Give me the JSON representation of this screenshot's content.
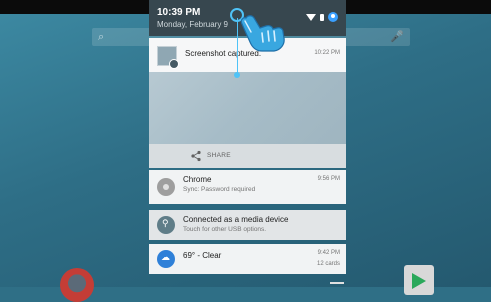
{
  "status": {
    "time": "10:39 PM",
    "date": "Monday, February 9"
  },
  "notifications": {
    "screenshot": {
      "title": "Screenshot captured.",
      "time": "10:22 PM",
      "action": "SHARE"
    },
    "chrome": {
      "title": "Chrome",
      "subtitle": "Sync: Password required",
      "time": "9:56 PM"
    },
    "usb": {
      "title": "Connected as a media device",
      "subtitle": "Touch for other USB options."
    },
    "weather": {
      "title": "69° - Clear",
      "time": "9:42 PM",
      "meta": "12 cards"
    }
  },
  "icons": {
    "status": [
      "wifi-icon",
      "battery-icon",
      "profile-icon"
    ],
    "notifications": [
      "screenshot-icon",
      "chrome-icon",
      "usb-icon",
      "weather-icon"
    ]
  },
  "colors": {
    "header": "#37474f",
    "accent": "#4fc3f7",
    "card": "#f1f3f4"
  }
}
